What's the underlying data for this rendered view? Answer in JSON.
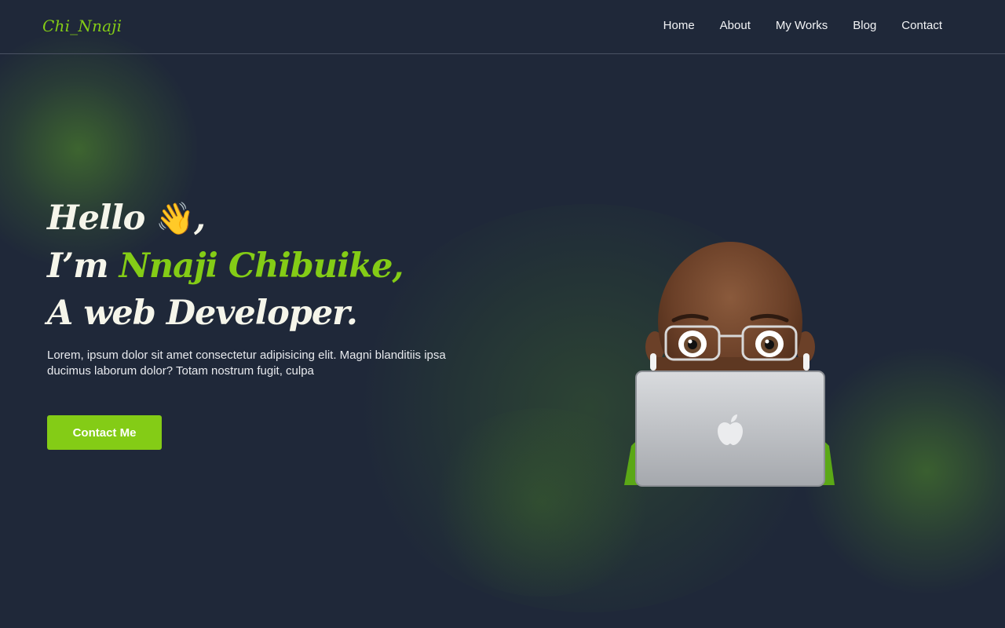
{
  "brand": {
    "logo": "Chi_Nnaji"
  },
  "nav": {
    "items": [
      {
        "label": "Home"
      },
      {
        "label": "About"
      },
      {
        "label": "My Works"
      },
      {
        "label": "Blog"
      },
      {
        "label": "Contact"
      }
    ]
  },
  "hero": {
    "greeting": "Hello",
    "wave_emoji": "👋",
    "greeting_suffix": ",",
    "intro_prefix": "I’m ",
    "name": "Nnaji Chibuike,",
    "role": "A web Developer.",
    "description": "Lorem, ipsum dolor sit amet consectetur adipisicing elit. Magni blanditiis ipsa ducimus laborum dolor? Totam nostrum fugit, culpa",
    "cta_label": "Contact Me"
  },
  "colors": {
    "background": "#1f2839",
    "accent": "#84cc16",
    "heading": "#f5f5ea"
  },
  "illustration": {
    "icon": "memoji-laptop-icon"
  }
}
